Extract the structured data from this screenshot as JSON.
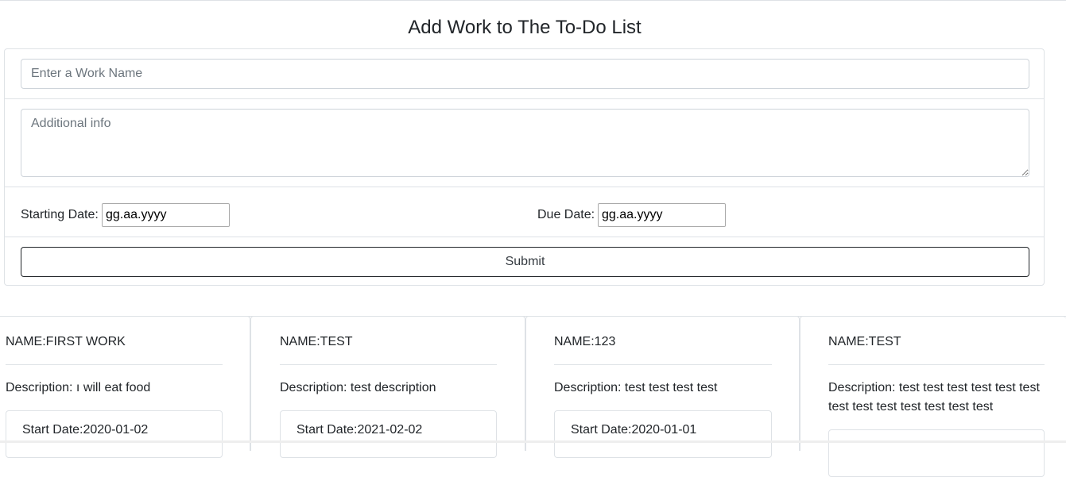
{
  "page": {
    "title": "Add Work to The To-Do List"
  },
  "form": {
    "work_name_placeholder": "Enter a Work Name",
    "additional_info_placeholder": "Additional info",
    "starting_date_label": "Starting Date:",
    "starting_date_value": "gg.aa.yyyy",
    "due_date_label": "Due Date:",
    "due_date_value": "gg.aa.yyyy",
    "submit_label": "Submit"
  },
  "works": [
    {
      "name": "NAME:FIRST WORK",
      "description": "Description: ı will eat food",
      "start": "Start Date:2020-01-02"
    },
    {
      "name": "NAME:TEST",
      "description": "Description: test description",
      "start": "Start Date:2021-02-02"
    },
    {
      "name": "NAME:123",
      "description": "Description: test test test test",
      "start": "Start Date:2020-01-01"
    },
    {
      "name": "NAME:TEST",
      "description": "Description: test test test test test test test test test test test test test",
      "start": ""
    }
  ]
}
